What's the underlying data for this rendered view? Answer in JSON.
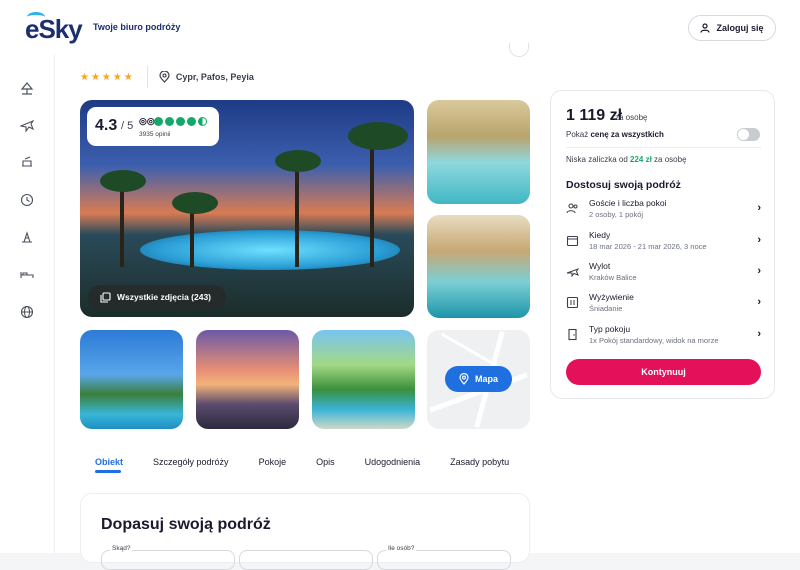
{
  "header": {
    "logo_text": "eSky",
    "tagline": "Twoje biuro podróży",
    "login_label": "Zaloguj się"
  },
  "sidebar": {
    "icons": [
      "beach-icon",
      "plane-icon",
      "flight-hotel-icon",
      "last-minute-icon",
      "ski-icon",
      "hotel-bed-icon",
      "globe-icon"
    ]
  },
  "hotel": {
    "stars": "★★★★★",
    "location": "Cypr, Pafos, Peyia"
  },
  "gallery": {
    "score": "4.3",
    "score_of": "/ 5",
    "reviews": "3935 opinii",
    "all_photos_label": "Wszystkie zdjęcia (243)",
    "map_label": "Mapa"
  },
  "tabs": [
    "Obiekt",
    "Szczegóły podróży",
    "Pokoje",
    "Opis",
    "Udogodnienia",
    "Zasady pobytu"
  ],
  "section": {
    "title": "Dopasuj swoją podróż",
    "from_label": "Skąd?",
    "people_label": "Ile osób?"
  },
  "booking": {
    "price": "1 119 zł",
    "price_unit": "za osobę",
    "show_total_prefix": "Pokaż ",
    "show_total_bold": "cenę za wszystkich",
    "deposit_prefix": "Niska zaliczka od ",
    "deposit_amount": "224 zł",
    "deposit_suffix": " za osobę",
    "customize_title": "Dostosuj swoją podróż",
    "options": [
      {
        "title": "Goście i liczba pokoi",
        "sub": "2 osoby, 1 pokój"
      },
      {
        "title": "Kiedy",
        "sub": "18 mar 2026 - 21 mar 2026, 3 noce"
      },
      {
        "title": "Wylot",
        "sub": "Kraków Balice"
      },
      {
        "title": "Wyżywienie",
        "sub": "Śniadanie"
      },
      {
        "title": "Typ pokoju",
        "sub": "1x Pokój standardowy, widok na morze"
      }
    ],
    "continue_label": "Kontynuuj"
  },
  "colors": {
    "brand_blue": "#1d2f6f",
    "accent_blue": "#1f6fe0",
    "cta_pink": "#e4105a",
    "rating_green": "#14a86b",
    "star_gold": "#f5a623"
  }
}
